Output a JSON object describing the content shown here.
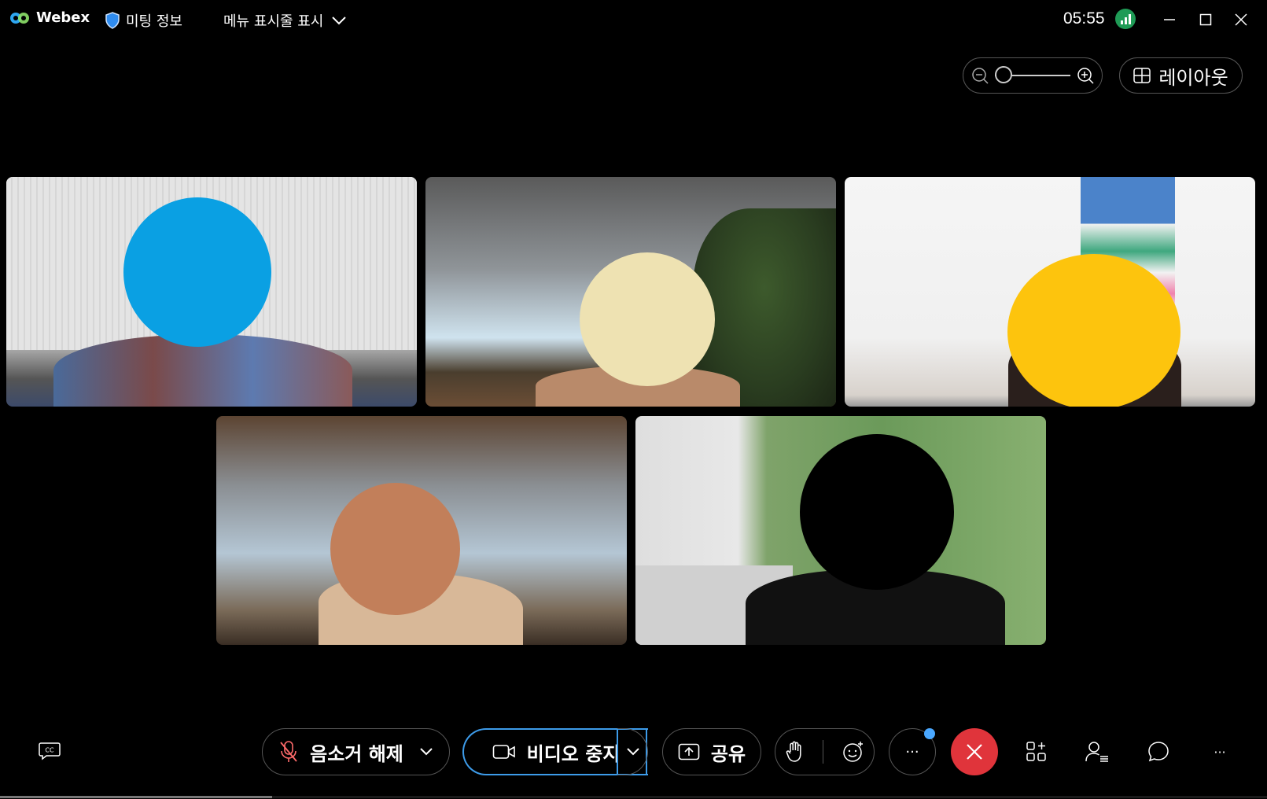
{
  "titlebar": {
    "app_name": "Webex",
    "meeting_info_label": "미팅 정보",
    "menu_toggle_label": "메뉴 표시줄 표시",
    "clock": "05:55"
  },
  "toolbar_top": {
    "zoom_level": 0,
    "layout_label": "레이아웃"
  },
  "bottom_bar": {
    "mute_label": "음소거 해제",
    "video_label": "비디오 중지",
    "share_label": "공유",
    "more_label": "···",
    "overflow_label": "···"
  },
  "colors": {
    "background": "#000000",
    "end_call": "#e0343b",
    "video_focus": "#3d9be9",
    "signal": "#1f9b56",
    "notify_dot": "#4aa8ff",
    "face_1": "#0aa0e3",
    "face_2": "#eee2b2",
    "face_3": "#fdc40d",
    "face_4": "#c27f5a",
    "face_5": "#000000"
  }
}
